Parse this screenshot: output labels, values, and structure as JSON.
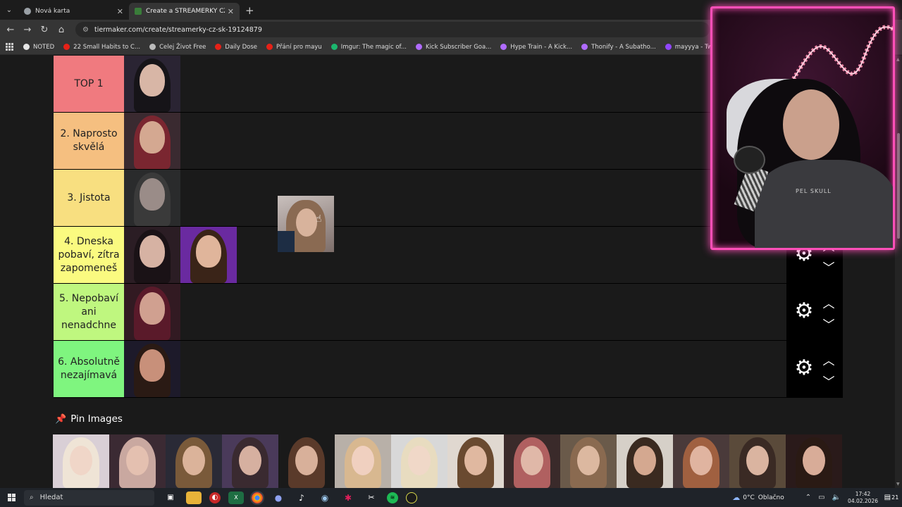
{
  "browser": {
    "tabs": [
      {
        "title": "Nová karta",
        "active": false,
        "favicon_color": "#9aa0a6"
      },
      {
        "title": "Create a STREAMERKY CZ/SK Tier List",
        "active": true,
        "favicon_color": "#3a7d3a"
      }
    ],
    "url": "tiermaker.com/create/streamerky-cz-sk-19124879",
    "bookmarks": [
      {
        "label": "NOTED",
        "color": "#e6e6e6"
      },
      {
        "label": "22 Small Habits to C...",
        "color": "#e62117"
      },
      {
        "label": "Celej Život Free",
        "color": "#bbbbbb"
      },
      {
        "label": "Daily Dose",
        "color": "#e62117"
      },
      {
        "label": "Přání pro mayu",
        "color": "#e62117"
      },
      {
        "label": "Imgur: The magic of...",
        "color": "#1bb76e"
      },
      {
        "label": "Kick Subscriber Goa...",
        "color": "#b06bff"
      },
      {
        "label": "Hype Train - A Kick...",
        "color": "#b06bff"
      },
      {
        "label": "Thonify - A Subatho...",
        "color": "#b06bff"
      },
      {
        "label": "mayyya - Twitch",
        "color": "#9146ff"
      }
    ]
  },
  "tiers": [
    {
      "label": "TOP 1",
      "color": "#f07a7f"
    },
    {
      "label": "2. Naprosto skvělá",
      "color": "#f5bf80"
    },
    {
      "label": "3. Jistota",
      "color": "#f8df80"
    },
    {
      "label": "4. Dneska pobaví, zítra zapomeneš",
      "color": "#fafa80"
    },
    {
      "label": "5. Nepobaví ani nenadchne",
      "color": "#bff77f"
    },
    {
      "label": "6. Absolutně nezajímavá",
      "color": "#7ff57f"
    }
  ],
  "pin": {
    "heading": "Pin Images"
  },
  "webcam": {
    "shirt_text": "PEL SKULL"
  },
  "taskbar": {
    "search_placeholder": "Hledat",
    "temperature": "0°C",
    "weather": "Oblačno",
    "time": "17:42",
    "date": "04.02.2026",
    "notifications": "21"
  },
  "icons": {
    "back": "arrow-left-icon",
    "forward": "arrow-right-icon",
    "reload": "reload-icon",
    "home": "home-icon",
    "tier_settings": "gear-icon",
    "move_up": "chevron-up-icon",
    "move_down": "chevron-down-icon",
    "pin": "pushpin-icon"
  }
}
